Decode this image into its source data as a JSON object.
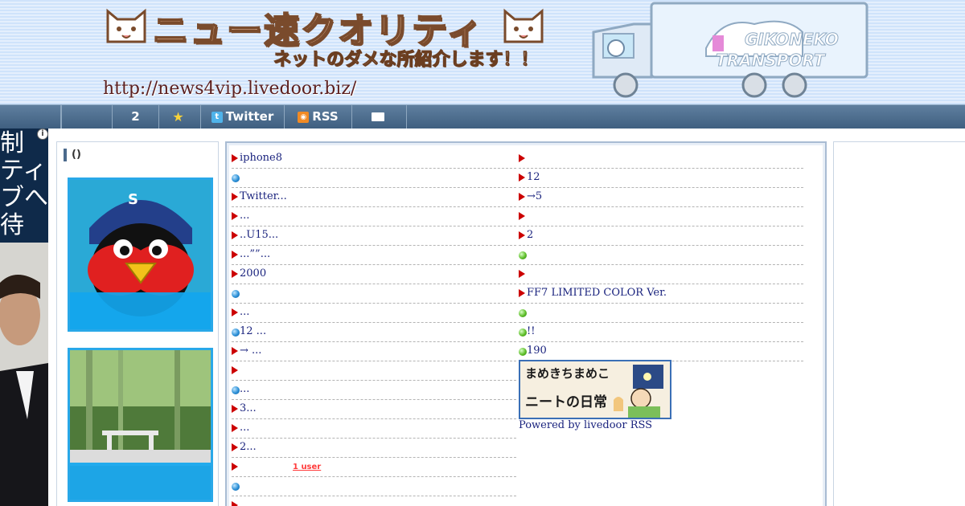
{
  "header": {
    "title": "ニュー速クオリティ",
    "subtitle": "ネットのダメな所紹介します！！",
    "url": "http://news4vip.livedoor.biz/",
    "truck_text_line1": "GIKONEKO",
    "truck_text_line2": "TRANSPORT"
  },
  "nav": {
    "items": [
      {
        "label": "",
        "icon": ""
      },
      {
        "label": "2",
        "icon": ""
      },
      {
        "label": "",
        "icon": "star-icon"
      },
      {
        "label": "Twitter",
        "icon": "twitter-icon"
      },
      {
        "label": "RSS",
        "icon": "rss-icon"
      },
      {
        "label": "",
        "icon": "mail-icon"
      }
    ]
  },
  "left_ad": {
    "lines": [
      "制",
      "ティ",
      "ブへ",
      "待"
    ]
  },
  "sidebar": {
    "heading": "()"
  },
  "main": {
    "left_rows": [
      {
        "marker": "tri",
        "text": "iphone8"
      },
      {
        "marker": "blue",
        "text": ""
      },
      {
        "marker": "tri",
        "text": "Twitter..."
      },
      {
        "marker": "tri",
        "text": "..."
      },
      {
        "marker": "tri",
        "text": "..U15..."
      },
      {
        "marker": "tri",
        "text": "...””..."
      },
      {
        "marker": "tri",
        "text": "2000"
      },
      {
        "marker": "blue",
        "text": ""
      },
      {
        "marker": "tri",
        "text": "..."
      },
      {
        "marker": "blue",
        "text": "12 ..."
      },
      {
        "marker": "tri",
        "text": "→ ..."
      },
      {
        "marker": "tri",
        "text": ""
      },
      {
        "marker": "blue",
        "text": "..."
      },
      {
        "marker": "tri",
        "text": "3..."
      },
      {
        "marker": "tri",
        "text": " ..."
      },
      {
        "marker": "tri",
        "text": "2..."
      },
      {
        "marker": "tri",
        "text": "",
        "badge": "1 user"
      },
      {
        "marker": "blue",
        "text": ""
      },
      {
        "marker": "tri",
        "text": ""
      }
    ],
    "right_rows": [
      {
        "marker": "tri",
        "text": ""
      },
      {
        "marker": "tri",
        "text": " 12"
      },
      {
        "marker": "tri",
        "text": "→5"
      },
      {
        "marker": "tri",
        "text": ""
      },
      {
        "marker": "tri",
        "text": "2"
      },
      {
        "marker": "green",
        "text": ""
      },
      {
        "marker": "tri",
        "text": ""
      },
      {
        "marker": "tri",
        "text": "FF7 LIMITED COLOR Ver."
      },
      {
        "marker": "green",
        "text": ""
      },
      {
        "marker": "green",
        "text": " !!"
      },
      {
        "marker": "green",
        "text": "190"
      }
    ],
    "banner_line1": "まめきちまめこ",
    "banner_line2": "ニートの日常",
    "powered_by": "Powered by livedoor RSS"
  },
  "colors": {
    "nav_bg": "#4a6a8b",
    "link": "#1a237e",
    "marker_red": "#cc0000",
    "thumb_border": "#29a8e8"
  }
}
